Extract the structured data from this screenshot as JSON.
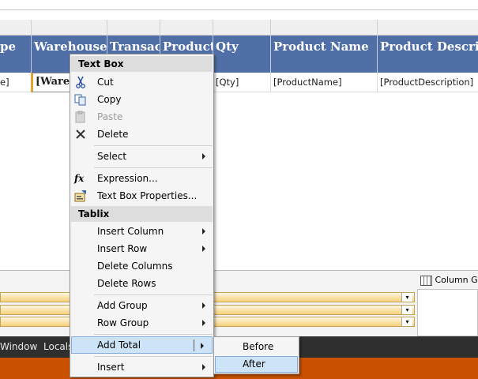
{
  "tablix": {
    "headers": [
      "pe",
      "Warehouse",
      "Transac",
      "Product",
      "Qty",
      "Product Name",
      "Product Descript"
    ],
    "detail": [
      "e]",
      "[Wareh",
      "",
      "",
      "[Qty]",
      "[ProductName]",
      "[ProductDescription]"
    ]
  },
  "grouping": {
    "column_groups_label": "Column Gr",
    "dropdown_glyph": "▾"
  },
  "tabs": {
    "window": "Window",
    "locals": "Locals"
  },
  "context_menu": {
    "textbox_header": "Text Box",
    "cut": "Cut",
    "copy": "Copy",
    "paste": "Paste",
    "delete": "Delete",
    "select": "Select",
    "expression": "Expression...",
    "textbox_properties": "Text Box Properties...",
    "tablix_header": "Tablix",
    "insert_column": "Insert Column",
    "insert_row": "Insert Row",
    "delete_columns": "Delete Columns",
    "delete_rows": "Delete Rows",
    "add_group": "Add Group",
    "row_group": "Row Group",
    "add_total": "Add Total",
    "insert": "Insert"
  },
  "submenu": {
    "before": "Before",
    "after": "After"
  },
  "colors": {
    "header_bg": "#4f6fa6",
    "highlight": "#cde3f7",
    "status_bar": "#ca5100",
    "tab_strip": "#2f2f2f"
  }
}
